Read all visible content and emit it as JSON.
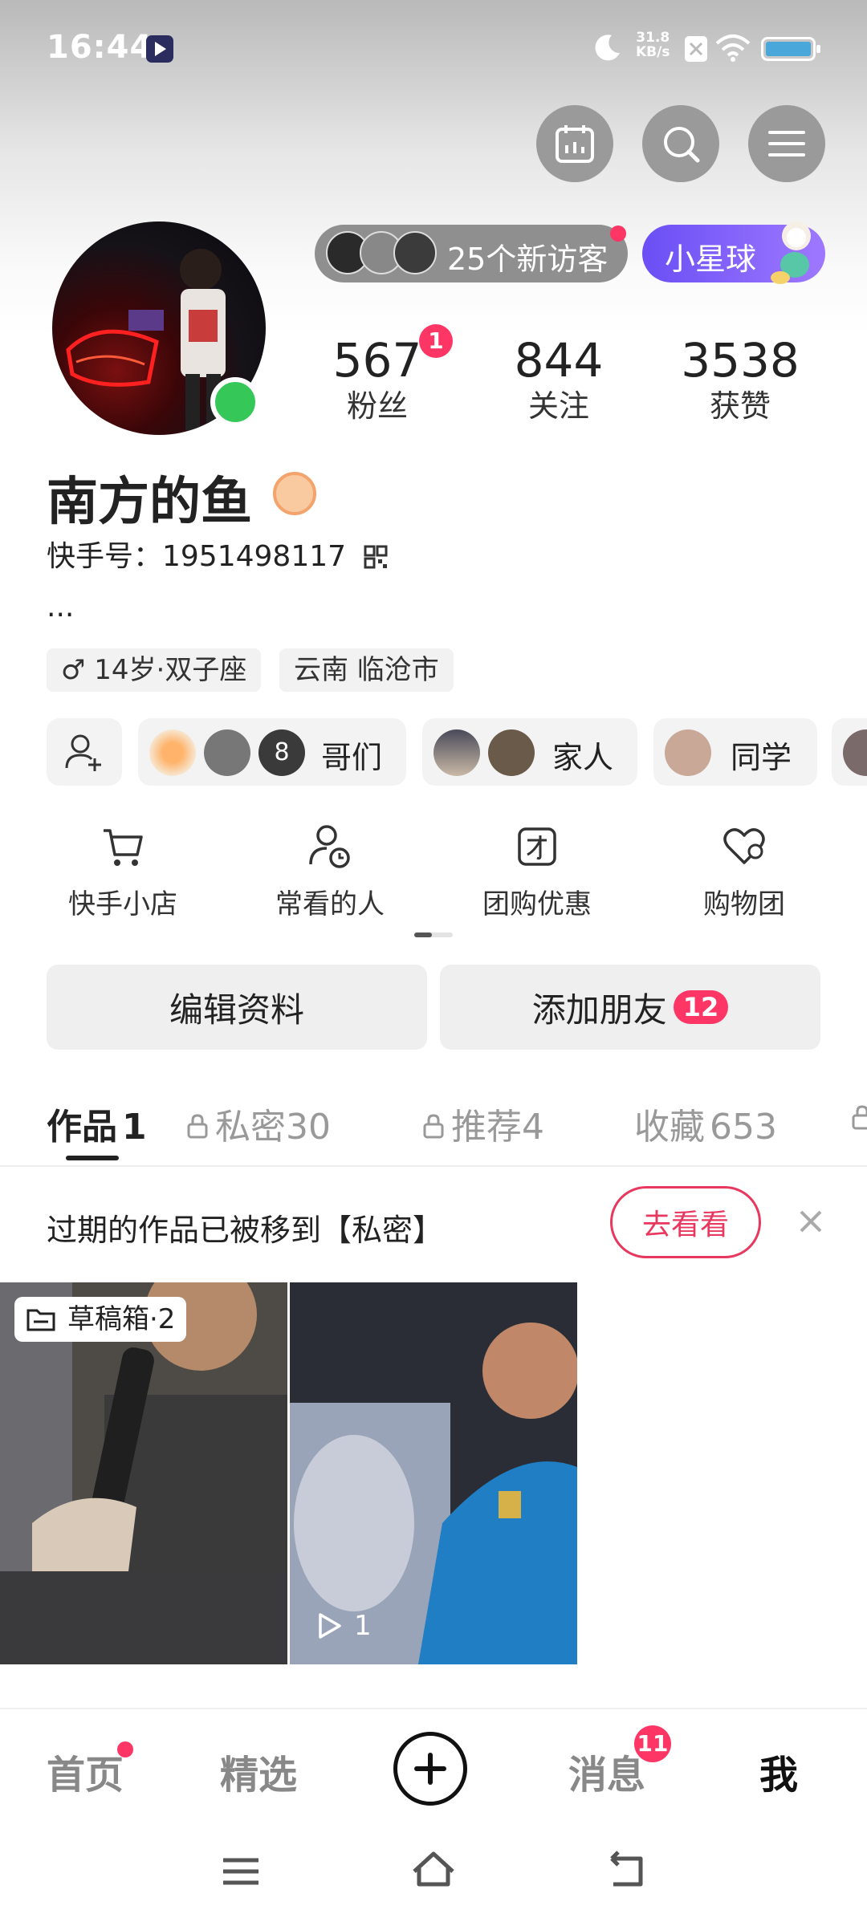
{
  "status_bar": {
    "time": "16:44",
    "net_speed": "31.8",
    "net_unit": "KB/s",
    "battery_color": "#4aa7d9"
  },
  "header_icons": [
    "calendar-icon",
    "search-icon",
    "menu-icon"
  ],
  "profile": {
    "visitors_label": "25个新访客",
    "planet_label": "小星球",
    "name": "南方的鱼",
    "kuaishou_id": "快手号：1951498117",
    "bio": "...",
    "tags": [
      "♂ 14岁·双子座",
      "云南 临沧市"
    ]
  },
  "stats": [
    {
      "value": "567",
      "label": "粉丝",
      "badge": "1"
    },
    {
      "value": "844",
      "label": "关注"
    },
    {
      "value": "3538",
      "label": "获赞"
    }
  ],
  "groups": [
    {
      "count": "8",
      "label": "哥们"
    },
    {
      "label": "家人"
    },
    {
      "label": "同学"
    }
  ],
  "shortcuts": [
    {
      "label": "快手小店",
      "icon": "cart-icon"
    },
    {
      "label": "常看的人",
      "icon": "person-clock-icon"
    },
    {
      "label": "团购优惠",
      "icon": "group-buy-icon"
    },
    {
      "label": "购物团",
      "icon": "heart-icon"
    }
  ],
  "actions": {
    "edit": "编辑资料",
    "add_friend": "添加朋友",
    "add_friend_badge": "12"
  },
  "tabs": [
    {
      "label": "作品",
      "count": "1"
    },
    {
      "label": "私密",
      "count": "30"
    },
    {
      "label": "推荐",
      "count": "4"
    },
    {
      "label": "收藏",
      "count": "653"
    }
  ],
  "notice": {
    "text": "过期的作品已被移到【私密】",
    "button": "去看看"
  },
  "grid": {
    "draft_label": "草稿箱·2",
    "play_count": "1"
  },
  "bottom_nav": {
    "home": "首页",
    "featured": "精选",
    "messages": "消息",
    "messages_badge": "11",
    "me": "我"
  },
  "colors": {
    "accent": "#fe3666",
    "planet": "#7c5cf8",
    "online": "#36c759"
  }
}
